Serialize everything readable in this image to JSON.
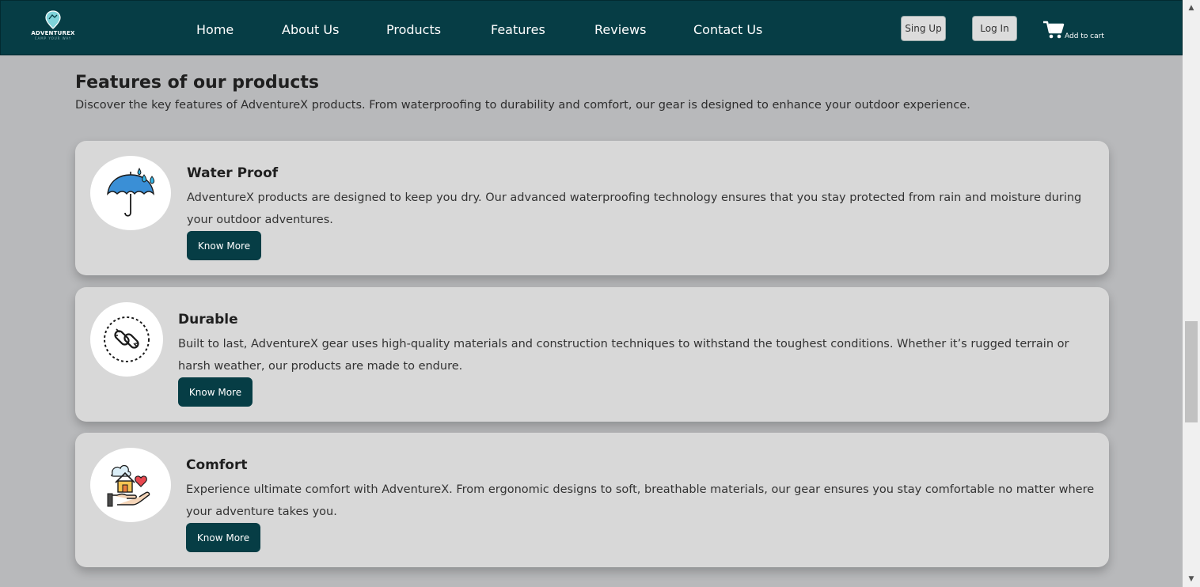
{
  "brand": {
    "name": "ADVENTUREX",
    "tagline": "CAMP YOUR WAY",
    "accent": "#063d45",
    "logo_icon": "map-pin-icon"
  },
  "nav": {
    "links": [
      "Home",
      "About Us",
      "Products",
      "Features",
      "Reviews",
      "Contact Us"
    ],
    "signup_label": "Sing Up",
    "login_label": "Log In",
    "cart_label": "Add to cart",
    "cart_icon": "cart-icon"
  },
  "features": {
    "title": "Features of our products",
    "description": "Discover the key features of AdventureX products. From waterproofing to durability and comfort, our gear is designed to enhance your outdoor experience.",
    "cards": [
      {
        "title": "Water Proof",
        "text": "AdventureX products are designed to keep you dry. Our advanced waterproofing technology ensures that you stay protected from rain and moisture during your outdoor adventures.",
        "button": "Know More",
        "icon": "umbrella-rain-icon"
      },
      {
        "title": "Durable",
        "text": "Built to last, AdventureX gear uses high-quality materials and construction techniques to withstand the toughest conditions. Whether it’s rugged terrain or harsh weather, our products are made to endure.",
        "button": "Know More",
        "icon": "chain-link-icon"
      },
      {
        "title": "Comfort",
        "text": "Experience ultimate comfort with AdventureX. From ergonomic designs to soft, breathable materials, our gear ensures you stay comfortable no matter where your adventure takes you.",
        "button": "Know More",
        "icon": "home-care-icon"
      }
    ]
  }
}
